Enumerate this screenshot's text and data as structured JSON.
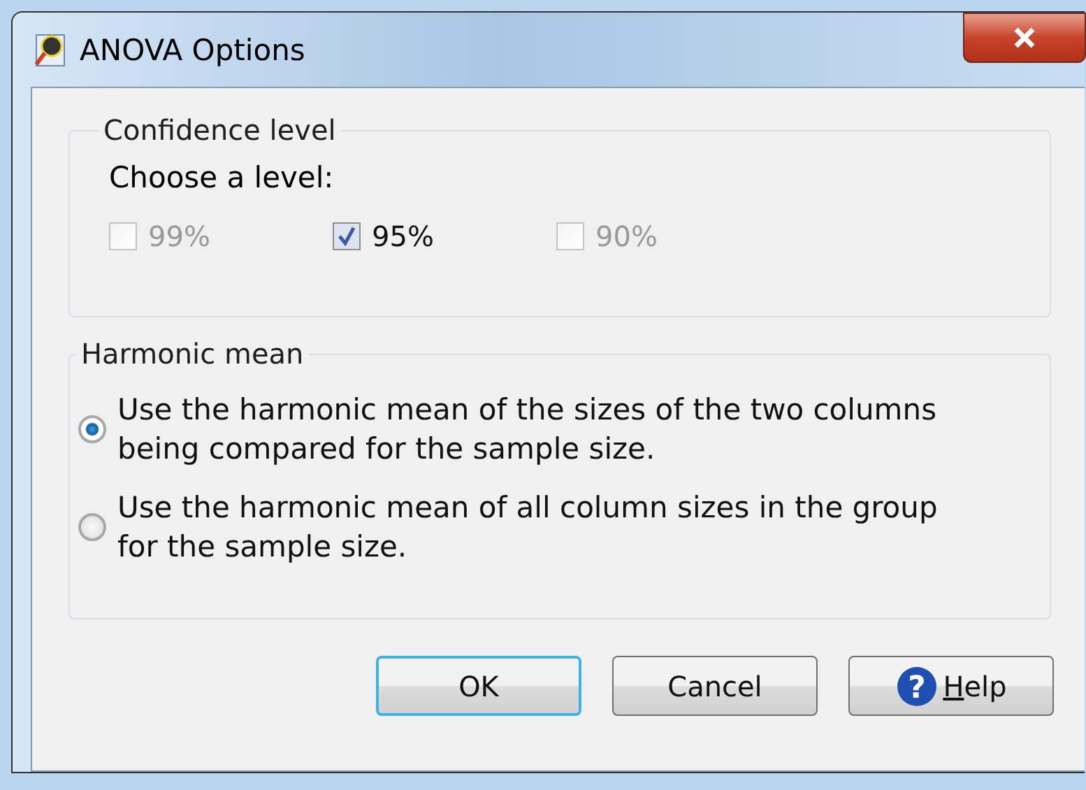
{
  "window": {
    "title": "ANOVA Options"
  },
  "confidence": {
    "title": "Confidence level",
    "prompt": "Choose a level:",
    "options": [
      {
        "label": "99%",
        "checked": false,
        "disabled": true
      },
      {
        "label": "95%",
        "checked": true,
        "disabled": false
      },
      {
        "label": "90%",
        "checked": false,
        "disabled": true
      }
    ]
  },
  "harmonic": {
    "title": "Harmonic mean",
    "options": [
      {
        "label": "Use the harmonic mean of the sizes of the two columns being compared for the sample size.",
        "selected": true
      },
      {
        "label": "Use the harmonic mean of all column sizes in the group for the sample size.",
        "selected": false
      }
    ]
  },
  "buttons": [
    {
      "label": "OK",
      "kind": "default"
    },
    {
      "label": "Cancel",
      "kind": "plain"
    },
    {
      "label": "Help",
      "kind": "help",
      "icon": "?"
    }
  ]
}
